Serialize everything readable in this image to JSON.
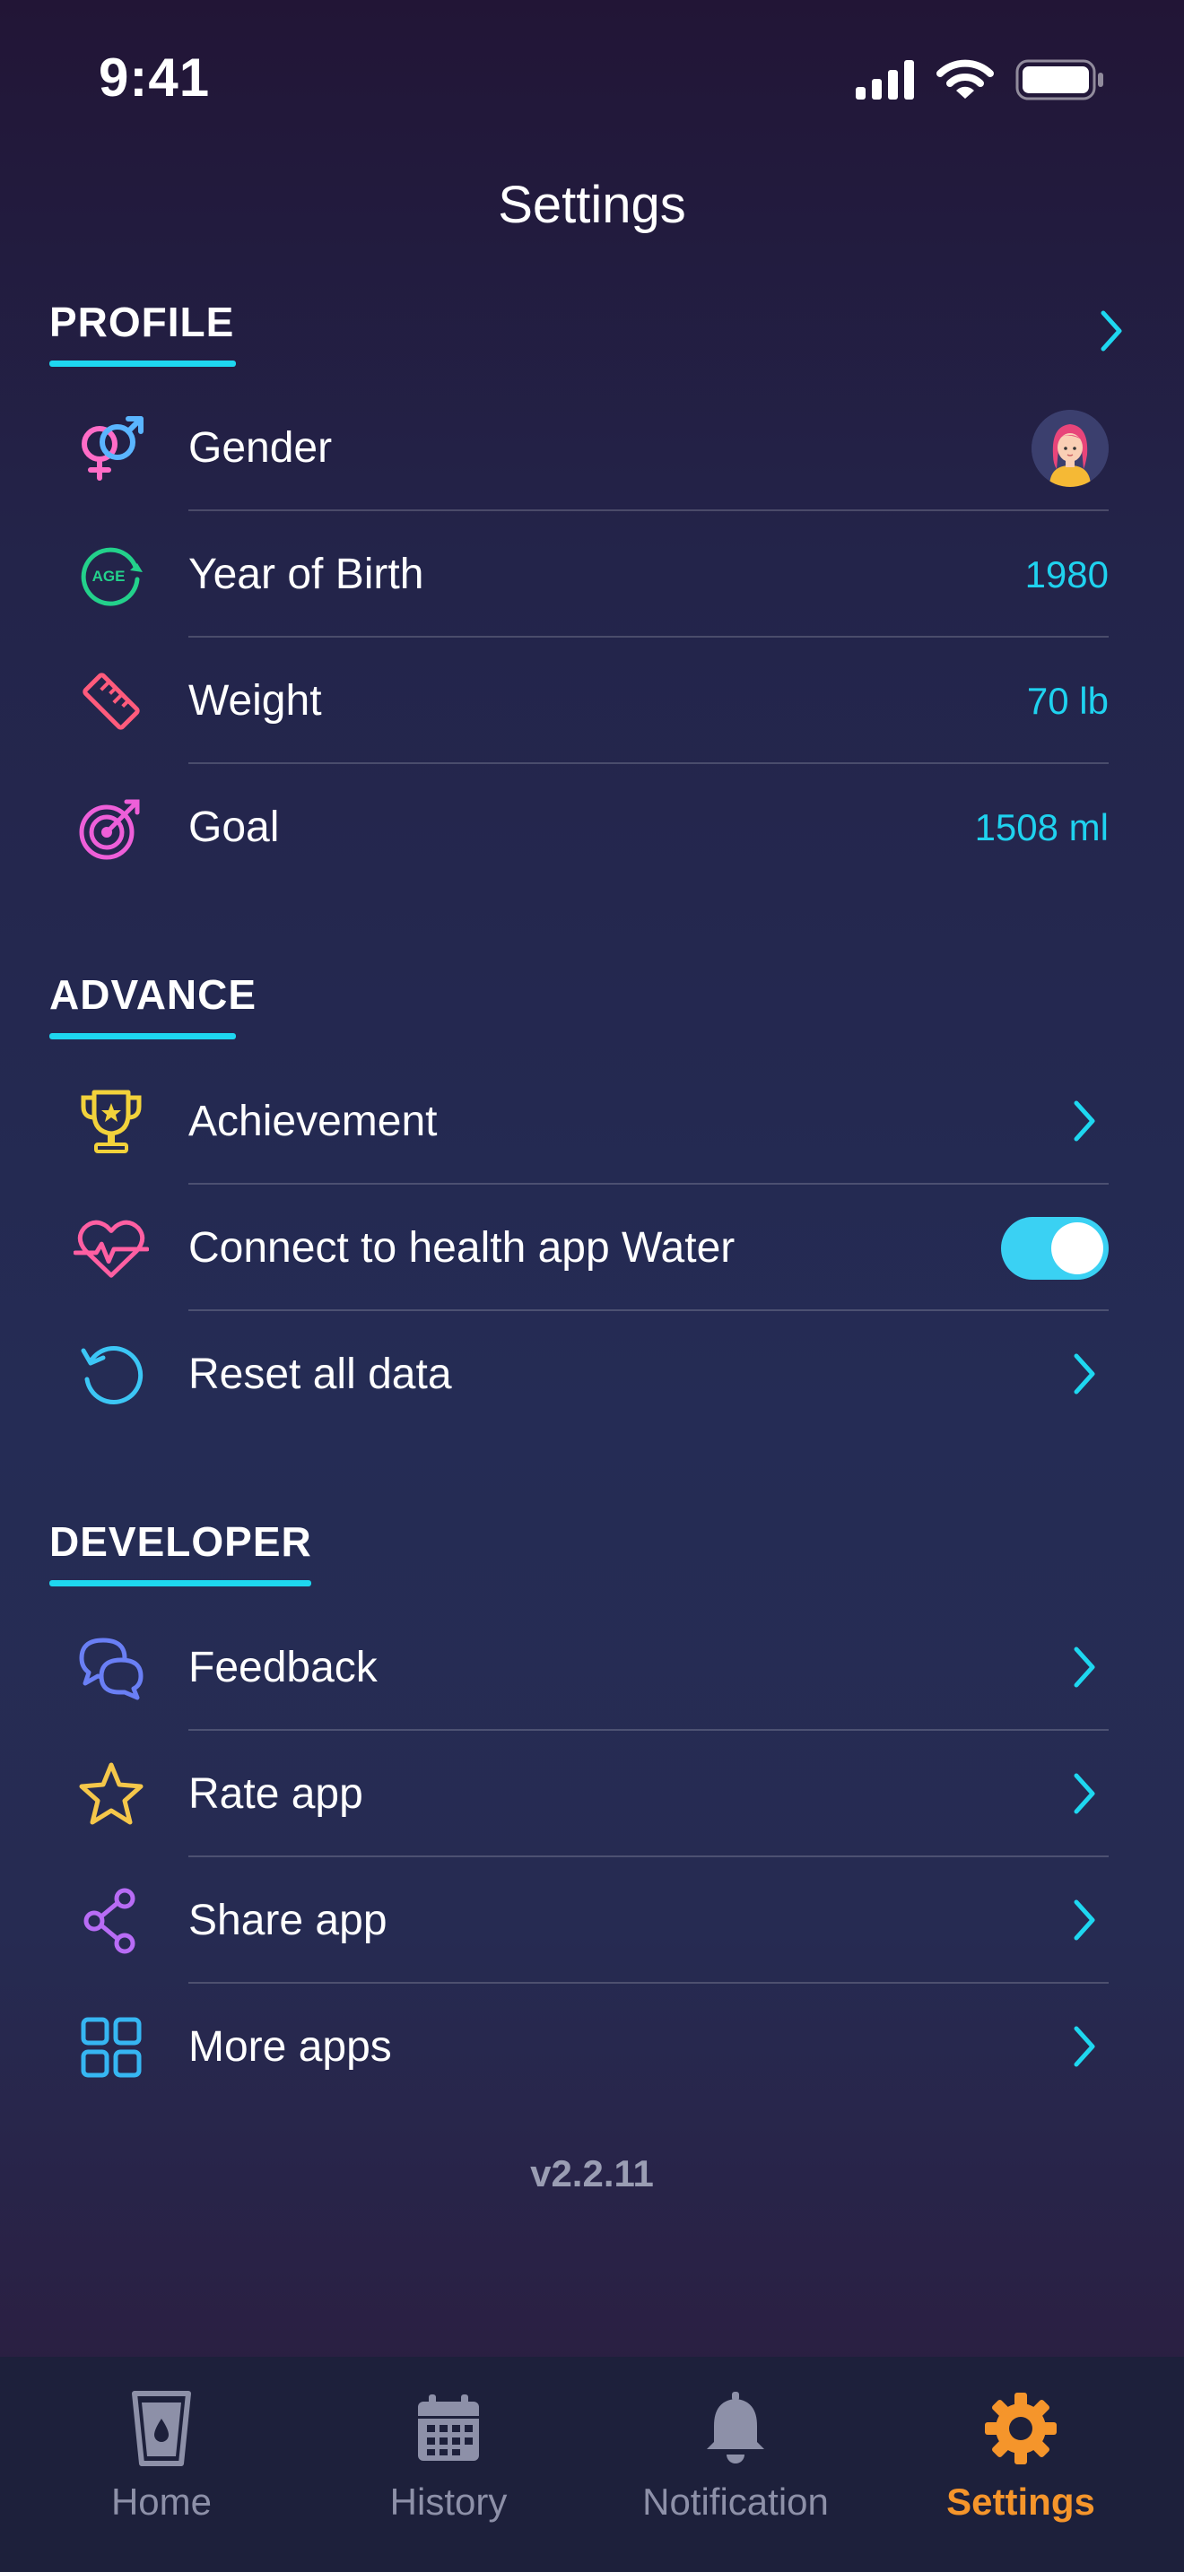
{
  "status_bar": {
    "time": "9:41"
  },
  "page_title": "Settings",
  "sections": {
    "profile": {
      "title": "PROFILE",
      "rows": [
        {
          "label": "Gender",
          "value": ""
        },
        {
          "label": "Year of Birth",
          "value": "1980"
        },
        {
          "label": "Weight",
          "value": "70 lb"
        },
        {
          "label": "Goal",
          "value": "1508 ml"
        }
      ]
    },
    "advance": {
      "title": "ADVANCE",
      "rows": [
        {
          "label": "Achievement"
        },
        {
          "label": "Connect to health app Water",
          "toggle_on": true
        },
        {
          "label": "Reset all data"
        }
      ]
    },
    "developer": {
      "title": "DEVELOPER",
      "rows": [
        {
          "label": "Feedback"
        },
        {
          "label": "Rate app"
        },
        {
          "label": "Share app"
        },
        {
          "label": "More apps"
        }
      ]
    }
  },
  "age_icon_text": "AGE",
  "version": "v2.2.11",
  "tabs": [
    {
      "label": "Home",
      "icon": "water-glass-icon",
      "active": false
    },
    {
      "label": "History",
      "icon": "calendar-icon",
      "active": false
    },
    {
      "label": "Notification",
      "icon": "bell-icon",
      "active": false
    },
    {
      "label": "Settings",
      "icon": "gear-icon",
      "active": true
    }
  ],
  "colors": {
    "accent": "#1ed7f0",
    "active_tab": "#f5952b",
    "inactive_tab": "#8d90a8",
    "toggle_on": "#3ad1f3"
  }
}
